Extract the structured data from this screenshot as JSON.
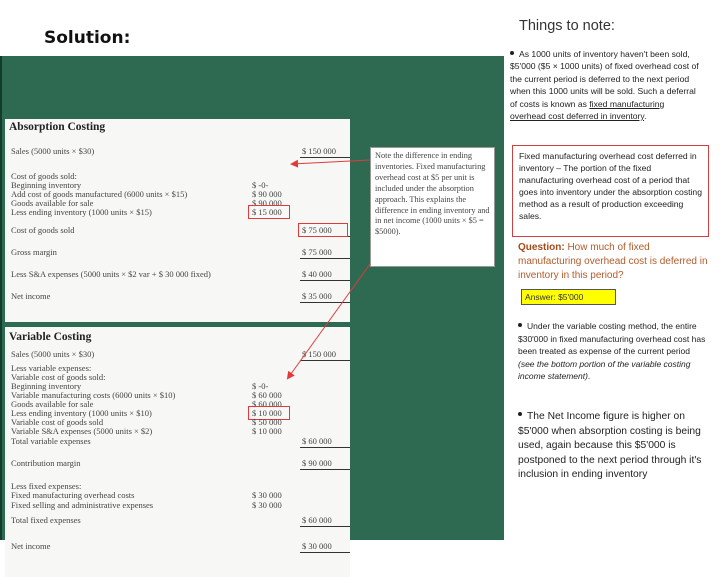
{
  "header": {
    "solution": "Solution:",
    "things_to_note": "Things to note:"
  },
  "absorption": {
    "title": "Absorption Costing",
    "lines": [
      {
        "label": "Sales (5000 units × $30)",
        "right": "$ 150 000"
      },
      {
        "label": "Cost of goods sold:",
        "right": ""
      },
      {
        "label": "Beginning inventory",
        "mid": "$ -0-"
      },
      {
        "label": "Add cost of goods manufactured (6000 units × $15)",
        "mid": "$ 90 000"
      },
      {
        "label": "Goods available for sale",
        "mid": "$ 90 000"
      },
      {
        "label": "Less ending inventory (1000 units × $15)",
        "mid": "$ 15 000"
      },
      {
        "label": "Cost of goods sold",
        "right": "$ 75 000"
      },
      {
        "label": "Gross margin",
        "right": "$ 75 000"
      },
      {
        "label": "Less S&A expenses (5000 units × $2 var + $ 30 000 fixed)",
        "right": "$ 40 000"
      },
      {
        "label": "Net income",
        "right": "$ 35 000"
      }
    ]
  },
  "variable": {
    "title": "Variable Costing",
    "lines": [
      {
        "label": "Sales (5000 units × $30)",
        "right": "$ 150 000"
      },
      {
        "label": "Less variable expenses:",
        "right": ""
      },
      {
        "label": "Variable cost of goods sold:",
        "right": ""
      },
      {
        "label": "Beginning inventory",
        "mid": "$ -0-"
      },
      {
        "label": "Variable manufacturing costs (6000 units × $10)",
        "mid": "$ 60 000"
      },
      {
        "label": "Goods available for sale",
        "mid": "$ 60 000"
      },
      {
        "label": "Less ending inventory (1000 units × $10)",
        "mid": "$ 10 000"
      },
      {
        "label": "Variable cost of goods sold",
        "mid": "$ 50 000"
      },
      {
        "label": "Variable S&A expenses (5000 units × $2)",
        "mid": "$ 10 000"
      },
      {
        "label": "Total variable expenses",
        "right": "$ 60 000"
      },
      {
        "label": "Contribution margin",
        "right": "$ 90 000"
      },
      {
        "label": "Less fixed expenses:",
        "right": ""
      },
      {
        "label": "Fixed manufacturing overhead costs",
        "mid": "$ 30 000"
      },
      {
        "label": "Fixed selling and administrative expenses",
        "mid": "$ 30 000"
      },
      {
        "label": "Total fixed expenses",
        "right": "$ 60 000"
      },
      {
        "label": "Net income",
        "right": "$ 30 000"
      }
    ]
  },
  "note_box": {
    "text": "Note the difference in ending inventories. Fixed manufacturing overhead cost at $5 per unit is included under the absorption approach. This explains the difference in ending inventory and in net income (1000 units × $5 = $5000)."
  },
  "bullet1": {
    "pre": "As 1000 units of inventory haven't been sold, $5'000 ($5 × 1000 units) of fixed overhead cost of the current period is deferred to the next period when this 1000 units will be sold. Such a deferral of costs is known as ",
    "underlined": "fixed manufacturing overhead cost deferred in inventory",
    "post": "."
  },
  "fixed_box": {
    "text": "Fixed manufacturing overhead cost deferred in inventory – The portion of the fixed manufacturing overhead cost of a period that goes into inventory under the absorption costing method as a result of production exceeding sales."
  },
  "question": {
    "label": "Question:",
    "text": " How much of fixed manufacturing overhead cost is deferred in inventory in this period?"
  },
  "answer": {
    "text": "Answer: $5'000"
  },
  "bullet2": {
    "pre": "Under the variable costing method, the entire $30'000 in fixed manufacturing overhead cost has been treated as expense of the current period ",
    "italic": "(see the bottom portion of the variable costing income statement)",
    "post": "."
  },
  "bullet3": {
    "text": "The Net Income figure is higher on $5'000 when absorption costing is being used, again because this $5'000 is postponed to the next period through it's inclusion in ending inventory"
  },
  "colors": {
    "panel": "#2e6a52",
    "highlight": "#e23a3a",
    "answer_bg": "#ffff00",
    "question": "#b15b2b"
  }
}
